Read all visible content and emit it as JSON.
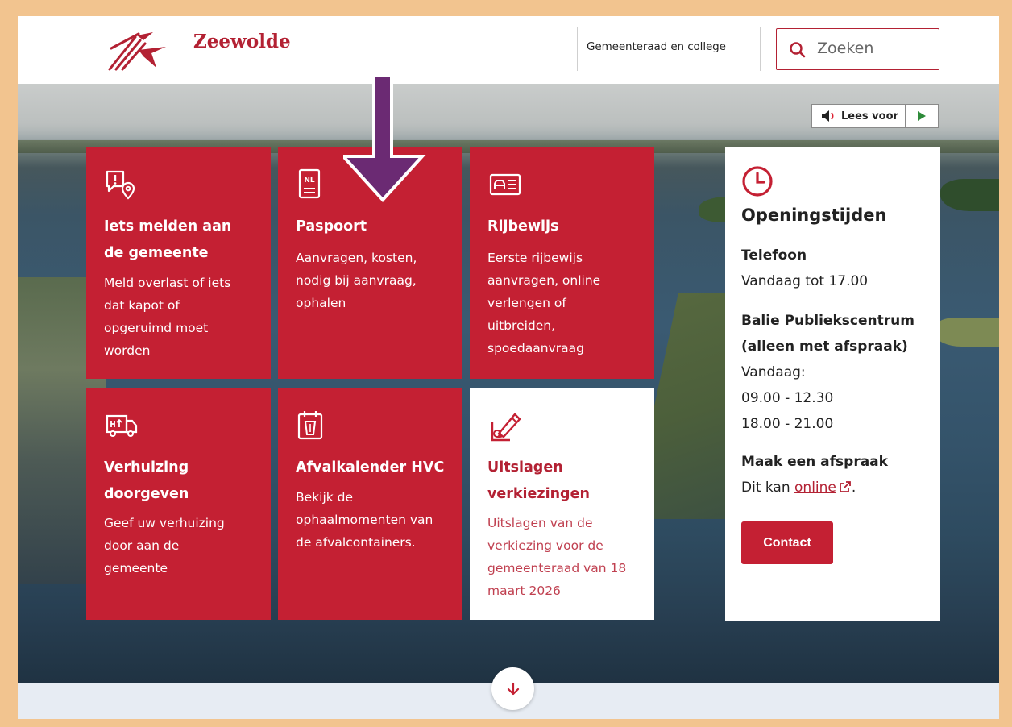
{
  "header": {
    "brand": "Zeewolde",
    "nav_link": "Gemeenteraad en college",
    "search_placeholder": "Zoeken"
  },
  "readspeaker": {
    "label": "Lees voor"
  },
  "tiles": [
    {
      "title_lines": [
        "Iets melden aan",
        "de gemeente"
      ],
      "desc_lines": [
        "Meld overlast of iets",
        "dat kapot of",
        "opgeruimd moet",
        "worden"
      ],
      "icon": "report-location-icon"
    },
    {
      "title_lines": [
        "Paspoort"
      ],
      "desc_lines": [
        "Aanvragen, kosten,",
        "nodig bij aanvraag,",
        "ophalen"
      ],
      "icon": "passport-icon",
      "icon_text": "NL"
    },
    {
      "title_lines": [
        "Rijbewijs"
      ],
      "desc_lines": [
        "Eerste rijbewijs",
        "aanvragen, online",
        "verlengen of",
        "uitbreiden,",
        "spoedaanvraag"
      ],
      "icon": "drivers-license-icon"
    },
    {
      "title_lines": [
        "Verhuizing",
        "doorgeven"
      ],
      "desc_lines": [
        "Geef uw verhuizing",
        "door aan de",
        "gemeente"
      ],
      "icon": "moving-truck-icon"
    },
    {
      "title_lines": [
        "Afvalkalender HVC"
      ],
      "desc_lines": [
        "Bekijk de",
        "ophaalmomenten van",
        "de afvalcontainers."
      ],
      "icon": "waste-calendar-icon"
    },
    {
      "title_lines": [
        "Uitslagen",
        "verkiezingen"
      ],
      "desc_lines": [
        "Uitslagen van de",
        "verkiezing voor de",
        "gemeenteraad van 18",
        "maart 2026"
      ],
      "icon": "vote-pen-icon"
    }
  ],
  "hours": {
    "title": "Openingstijden",
    "phone_label": "Telefoon",
    "phone_value": "Vandaag tot 17.00",
    "desk_label_lines": [
      "Balie Publiekscentrum",
      "(alleen met afspraak)"
    ],
    "desk_value_lines": [
      "Vandaag:",
      "09.00 - 12.30",
      "18.00 - 21.00"
    ],
    "appointment_label": "Maak een afspraak",
    "appointment_prefix": "Dit kan ",
    "appointment_link": "online",
    "appointment_suffix": ".",
    "contact_button": "Contact"
  },
  "colors": {
    "brand_red": "#c42033",
    "annotation_arrow": "#6b2a73",
    "frame": "#f2c48f"
  }
}
